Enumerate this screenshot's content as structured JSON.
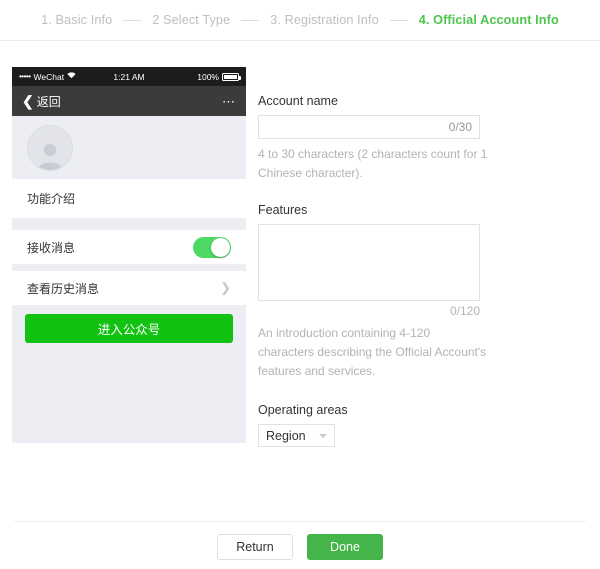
{
  "steps": {
    "items": [
      {
        "label": "1. Basic Info",
        "active": false
      },
      {
        "label": "2 Select Type",
        "active": false
      },
      {
        "label": "3. Registration Info",
        "active": false
      },
      {
        "label": "4. Official Account Info",
        "active": true
      }
    ],
    "active_color": "#4cc64c",
    "inactive_color": "#bfbfbf"
  },
  "phone_preview": {
    "status_bar": {
      "signal_dots": "•••••",
      "carrier": "WeChat",
      "wifi_icon": "wifi-icon",
      "time": "1:21 AM",
      "battery_percent": "100%",
      "battery_icon": "battery-full-icon"
    },
    "nav_bar": {
      "back_icon": "chevron-left-icon",
      "back_label": "返回",
      "more_icon": "more-dots-icon"
    },
    "avatar": {
      "icon": "user-placeholder-icon"
    },
    "intro_row_label": "功能介绍",
    "toggle_row": {
      "label": "接收消息",
      "state": "on",
      "track_color": "#4cd964"
    },
    "history_row": {
      "label": "查看历史消息",
      "arrow_icon": "chevron-right-icon"
    },
    "enter_button": {
      "label": "进入公众号",
      "color": "#11c211"
    }
  },
  "form": {
    "account_name": {
      "label": "Account name",
      "value": "",
      "counter": "0/30",
      "help": "4 to 30 characters (2 characters count for 1 Chinese character)."
    },
    "features": {
      "label": "Features",
      "value": "",
      "counter": "0/120",
      "help": "An introduction containing 4-120 characters describing the Official Account's features and services."
    },
    "operating_areas": {
      "label": "Operating areas",
      "selected": "Region",
      "caret_icon": "chevron-down-icon"
    }
  },
  "footer": {
    "return_label": "Return",
    "done_label": "Done",
    "done_color": "#45b549"
  }
}
